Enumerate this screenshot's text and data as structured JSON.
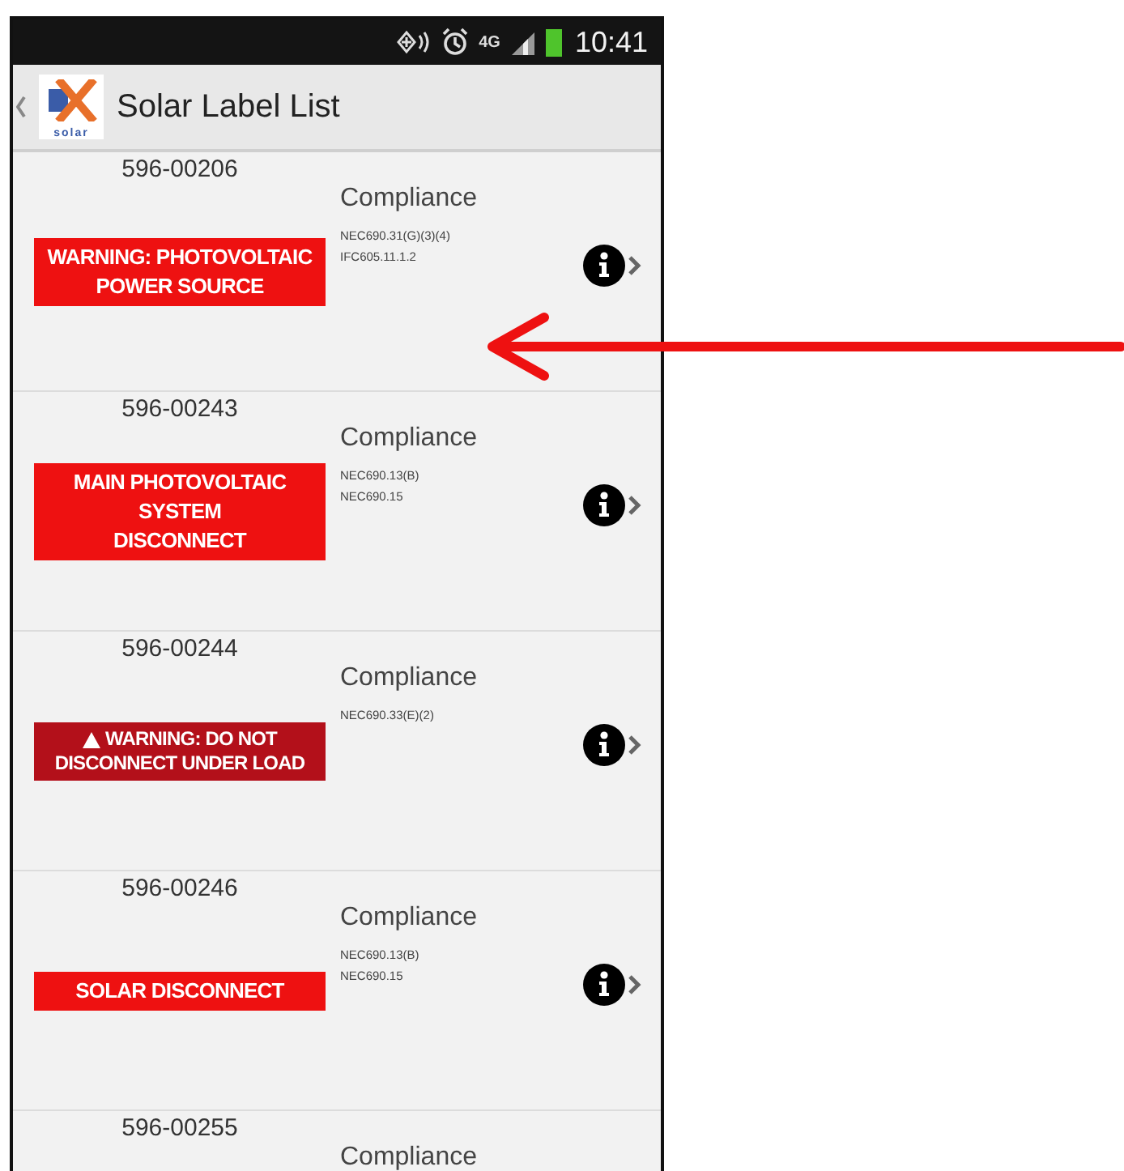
{
  "status_bar": {
    "network": "4G",
    "time": "10:41"
  },
  "action_bar": {
    "logo_text": "solar",
    "title": "Solar Label List"
  },
  "labels": [
    {
      "number": "596-00206",
      "heading": "Compliance",
      "codes": [
        "NEC690.31(G)(3)(4)",
        "IFC605.11.1.2"
      ],
      "sign": {
        "kind": "plain",
        "color": "#ee1111",
        "lines": [
          "WARNING: PHOTOVOLTAIC",
          "POWER SOURCE"
        ]
      }
    },
    {
      "number": "596-00243",
      "heading": "Compliance",
      "codes": [
        "NEC690.13(B)",
        "NEC690.15"
      ],
      "sign": {
        "kind": "plain",
        "color": "#ee1111",
        "lines": [
          "MAIN PHOTOVOLTAIC",
          "SYSTEM",
          "DISCONNECT"
        ]
      }
    },
    {
      "number": "596-00244",
      "heading": "Compliance",
      "codes": [
        "NEC690.33(E)(2)"
      ],
      "sign": {
        "kind": "warning",
        "color": "#b3101a",
        "lines": [
          "WARNING: DO NOT",
          "DISCONNECT UNDER LOAD"
        ]
      }
    },
    {
      "number": "596-00246",
      "heading": "Compliance",
      "codes": [
        "NEC690.13(B)",
        "NEC690.15"
      ],
      "sign": {
        "kind": "plain",
        "color": "#ee1111",
        "lines": [
          "SOLAR DISCONNECT"
        ]
      }
    },
    {
      "number": "596-00255",
      "heading": "Compliance"
    }
  ]
}
